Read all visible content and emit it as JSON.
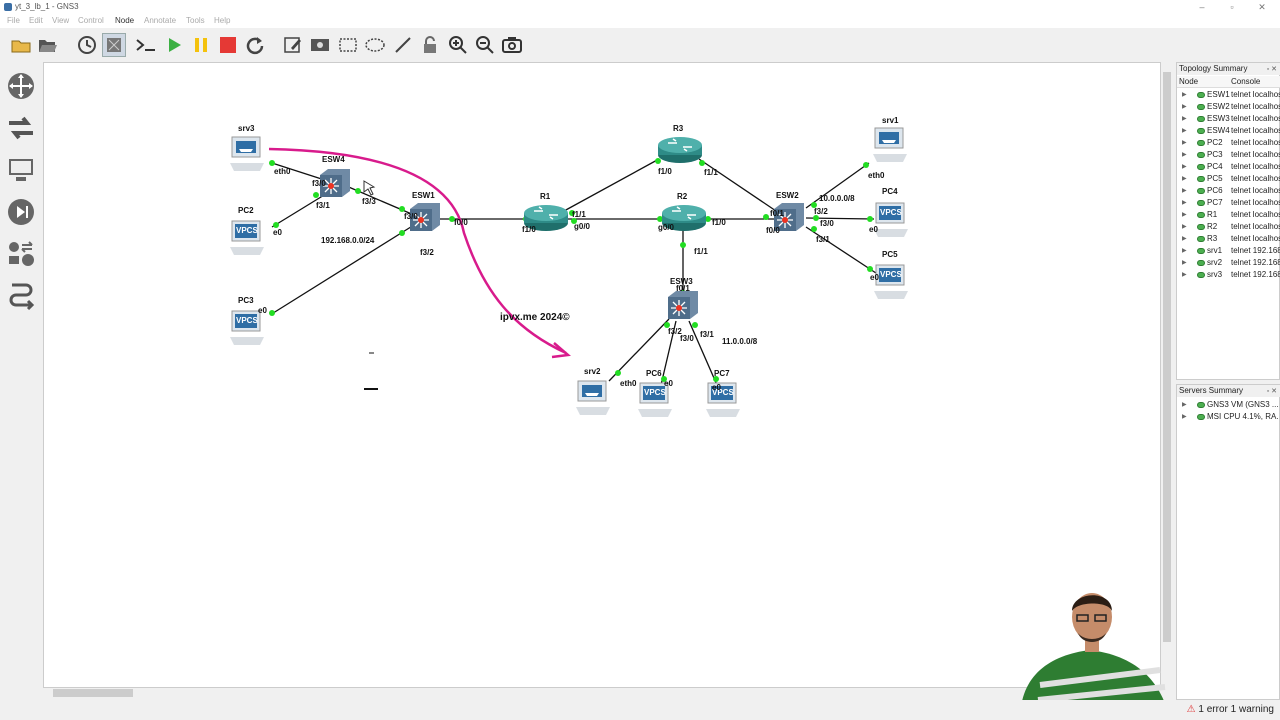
{
  "window": {
    "title": "yt_3_lb_1 - GNS3"
  },
  "menu": [
    "File",
    "Edit",
    "View",
    "Control",
    "Node",
    "Annotate",
    "Tools",
    "Help"
  ],
  "topology_summary": {
    "title": "Topology Summary",
    "col_node": "Node",
    "col_console": "Console",
    "rows": [
      {
        "node": "ESW1",
        "console": "telnet localhost"
      },
      {
        "node": "ESW2",
        "console": "telnet localhost"
      },
      {
        "node": "ESW3",
        "console": "telnet localhost"
      },
      {
        "node": "ESW4",
        "console": "telnet localhost"
      },
      {
        "node": "PC2",
        "console": "telnet localhost"
      },
      {
        "node": "PC3",
        "console": "telnet localhost"
      },
      {
        "node": "PC4",
        "console": "telnet localhost"
      },
      {
        "node": "PC5",
        "console": "telnet localhost"
      },
      {
        "node": "PC6",
        "console": "telnet localhost"
      },
      {
        "node": "PC7",
        "console": "telnet localhost"
      },
      {
        "node": "R1",
        "console": "telnet localhost"
      },
      {
        "node": "R2",
        "console": "telnet localhost"
      },
      {
        "node": "R3",
        "console": "telnet localhost"
      },
      {
        "node": "srv1",
        "console": "telnet 192.168"
      },
      {
        "node": "srv2",
        "console": "telnet 192.168"
      },
      {
        "node": "srv3",
        "console": "telnet 192.168"
      }
    ]
  },
  "servers_summary": {
    "title": "Servers Summary",
    "rows": [
      {
        "label": "GNS3 VM (GNS3 ..."
      },
      {
        "label": "MSI CPU 4.1%, RA..."
      }
    ]
  },
  "status": {
    "errors": "1 error 1 warning"
  },
  "topology": {
    "nodes": {
      "srv3": "srv3",
      "ESW4": "ESW4",
      "PC2": "PC2",
      "PC3": "PC3",
      "ESW1": "ESW1",
      "R1": "R1",
      "R3": "R3",
      "R2": "R2",
      "ESW2": "ESW2",
      "ESW3": "ESW3",
      "srv1": "srv1",
      "PC4": "PC4",
      "PC5": "PC5",
      "srv2": "srv2",
      "PC6": "PC6",
      "PC7": "PC7"
    },
    "port_labels": {
      "eth0_srv3": "eth0",
      "f3_0_esw4": "f3/0",
      "f3_1_esw4": "f3/1",
      "f3_3_esw4": "f3/3",
      "e0_pc2": "e0",
      "e0_pc3": "e0",
      "f3_0_esw1": "f3/0",
      "f0_0_esw1": "f0/0",
      "f3_2_esw1": "f3/2",
      "f1_1_r1": "f1/1",
      "f1_0_r1": "f1/0",
      "g0_0_r1": "g0/0",
      "f1_0_r3": "f1/0",
      "f1_1_r3": "f1/1",
      "g0_0_r2": "g0/0",
      "f1_0_r2": "f1/0",
      "f1_1_r2": "f1/1",
      "f0_1_esw2": "f0/1",
      "f0_0_esw2": "f0/0",
      "f3_2_esw2": "f3/2",
      "f3_0_esw2": "f3/0",
      "f3_1_esw2": "f3/1",
      "eth0_srv1": "eth0",
      "e0_pc4": "e0",
      "e0_pc5": "e0",
      "f0_1_esw3": "f0/1",
      "f3_2_esw3": "f3/2",
      "f3_0_esw3": "f3/0",
      "f3_1_esw3": "f3/1",
      "eth0_srv2": "eth0",
      "e0_pc6": "e0",
      "e0_pc7": "e0"
    },
    "subnets": {
      "lan1": "192.168.0.0/24",
      "lan2": "10.0.0.0/8",
      "lan3": "11.0.0.0/8"
    },
    "annotation": "ipvx.me 2024©",
    "vpcs_text": "VPCS"
  },
  "colors": {
    "link": "#111111",
    "port_up": "#22dd22",
    "pen": "#d81b8c",
    "router": "#2e8b87"
  }
}
